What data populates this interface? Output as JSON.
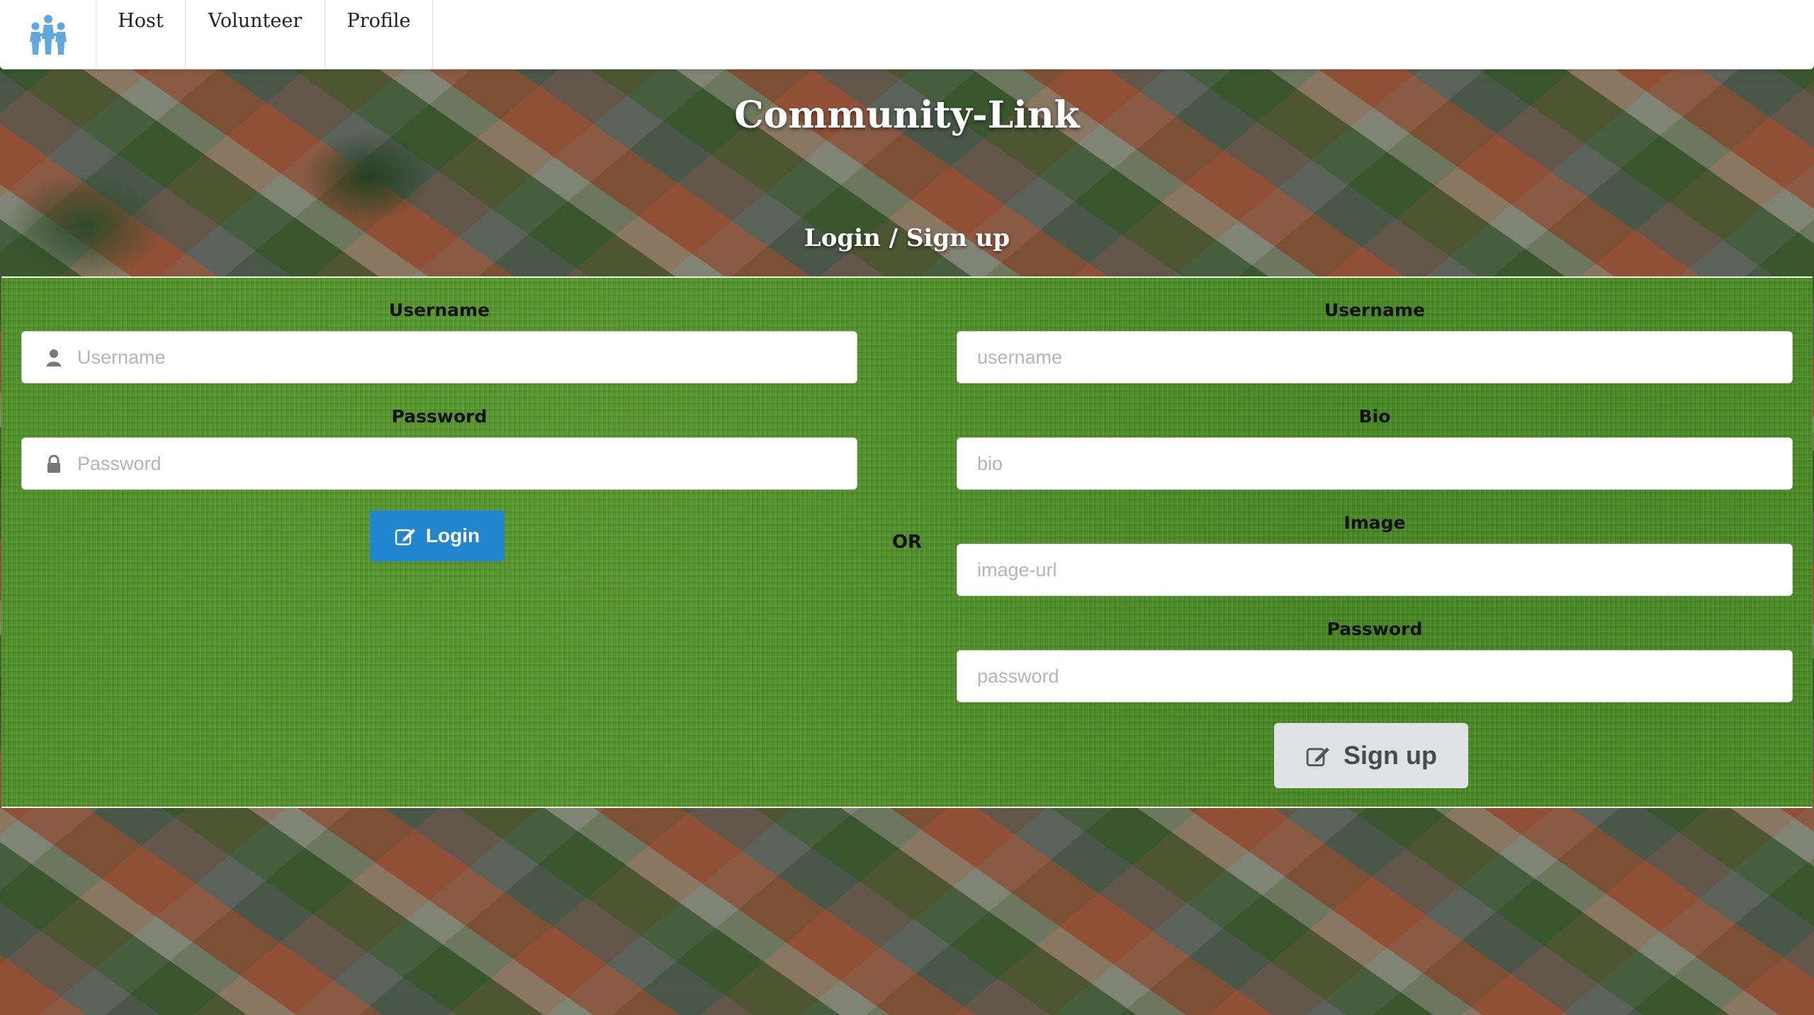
{
  "nav": {
    "logo_icon": "people-group-icon",
    "items": [
      {
        "label": "Host"
      },
      {
        "label": "Volunteer"
      },
      {
        "label": "Profile"
      }
    ]
  },
  "hero": {
    "title": "Community-Link",
    "subtitle": "Login / Sign up"
  },
  "login": {
    "username_label": "Username",
    "username_placeholder": "Username",
    "username_value": "",
    "password_label": "Password",
    "password_placeholder": "Password",
    "password_value": "",
    "button_label": "Login",
    "button_icon": "edit-icon",
    "button_color": "#2185d0"
  },
  "divider": {
    "text": "OR"
  },
  "signup": {
    "username_label": "Username",
    "username_placeholder": "username",
    "bio_label": "Bio",
    "bio_placeholder": "bio",
    "image_label": "Image",
    "image_placeholder": "image-url",
    "password_label": "Password",
    "password_placeholder": "password",
    "button_label": "Sign up",
    "button_icon": "edit-icon",
    "button_color": "#e0e1e2"
  }
}
